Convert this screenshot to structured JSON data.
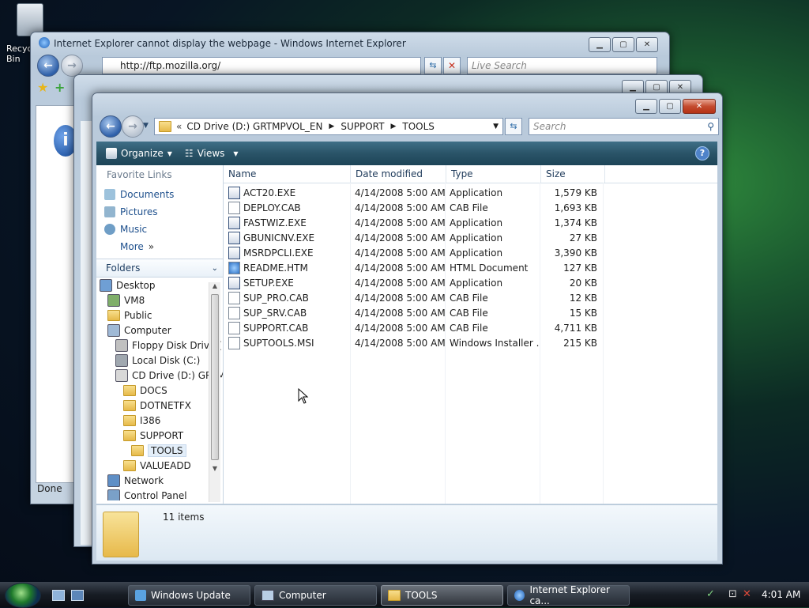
{
  "desktop": {
    "recycle_label": "Recycle Bin"
  },
  "ie": {
    "title": "Internet Explorer cannot display the webpage - Windows Internet Explorer",
    "url": "http://ftp.mozilla.org/",
    "search_placeholder": "Live Search",
    "status": "Done"
  },
  "explorer": {
    "breadcrumb": [
      "CD Drive (D:) GRTMPVOL_EN",
      "SUPPORT",
      "TOOLS"
    ],
    "search_placeholder": "Search",
    "toolbar": {
      "organize": "Organize",
      "views": "Views"
    },
    "favorite_links": {
      "header": "Favorite Links",
      "items": [
        "Documents",
        "Pictures",
        "Music"
      ],
      "more": "More"
    },
    "folders_header": "Folders",
    "tree": [
      {
        "label": "Desktop",
        "level": 0,
        "icon": "desktop"
      },
      {
        "label": "VM8",
        "level": 1,
        "icon": "user"
      },
      {
        "label": "Public",
        "level": 1,
        "icon": "folder"
      },
      {
        "label": "Computer",
        "level": 1,
        "icon": "computer"
      },
      {
        "label": "Floppy Disk Drive (",
        "level": 2,
        "icon": "floppy"
      },
      {
        "label": "Local Disk (C:)",
        "level": 2,
        "icon": "disk"
      },
      {
        "label": "CD Drive (D:) GRTM",
        "level": 2,
        "icon": "cd"
      },
      {
        "label": "DOCS",
        "level": 3,
        "icon": "folder"
      },
      {
        "label": "DOTNETFX",
        "level": 3,
        "icon": "folder"
      },
      {
        "label": "I386",
        "level": 3,
        "icon": "folder"
      },
      {
        "label": "SUPPORT",
        "level": 3,
        "icon": "folder"
      },
      {
        "label": "TOOLS",
        "level": 4,
        "icon": "folder",
        "selected": true
      },
      {
        "label": "VALUEADD",
        "level": 3,
        "icon": "folder"
      },
      {
        "label": "Network",
        "level": 1,
        "icon": "network"
      },
      {
        "label": "Control Panel",
        "level": 1,
        "icon": "control"
      }
    ],
    "columns": [
      "Name",
      "Date modified",
      "Type",
      "Size"
    ],
    "files": [
      {
        "name": "ACT20.EXE",
        "date": "4/14/2008 5:00 AM",
        "type": "Application",
        "size": "1,579 KB"
      },
      {
        "name": "DEPLOY.CAB",
        "date": "4/14/2008 5:00 AM",
        "type": "CAB File",
        "size": "1,693 KB"
      },
      {
        "name": "FASTWIZ.EXE",
        "date": "4/14/2008 5:00 AM",
        "type": "Application",
        "size": "1,374 KB"
      },
      {
        "name": "GBUNICNV.EXE",
        "date": "4/14/2008 5:00 AM",
        "type": "Application",
        "size": "27 KB"
      },
      {
        "name": "MSRDPCLI.EXE",
        "date": "4/14/2008 5:00 AM",
        "type": "Application",
        "size": "3,390 KB"
      },
      {
        "name": "README.HTM",
        "date": "4/14/2008 5:00 AM",
        "type": "HTML Document",
        "size": "127 KB"
      },
      {
        "name": "SETUP.EXE",
        "date": "4/14/2008 5:00 AM",
        "type": "Application",
        "size": "20 KB"
      },
      {
        "name": "SUP_PRO.CAB",
        "date": "4/14/2008 5:00 AM",
        "type": "CAB File",
        "size": "12 KB"
      },
      {
        "name": "SUP_SRV.CAB",
        "date": "4/14/2008 5:00 AM",
        "type": "CAB File",
        "size": "15 KB"
      },
      {
        "name": "SUPPORT.CAB",
        "date": "4/14/2008 5:00 AM",
        "type": "CAB File",
        "size": "4,711 KB"
      },
      {
        "name": "SUPTOOLS.MSI",
        "date": "4/14/2008 5:00 AM",
        "type": "Windows Installer ...",
        "size": "215 KB"
      }
    ],
    "details_count": "11 items"
  },
  "taskbar": {
    "buttons": [
      {
        "label": "Windows Update",
        "active": false
      },
      {
        "label": "Computer",
        "active": false
      },
      {
        "label": "TOOLS",
        "active": true
      },
      {
        "label": "Internet Explorer ca...",
        "active": false
      }
    ],
    "clock": "4:01 AM"
  }
}
